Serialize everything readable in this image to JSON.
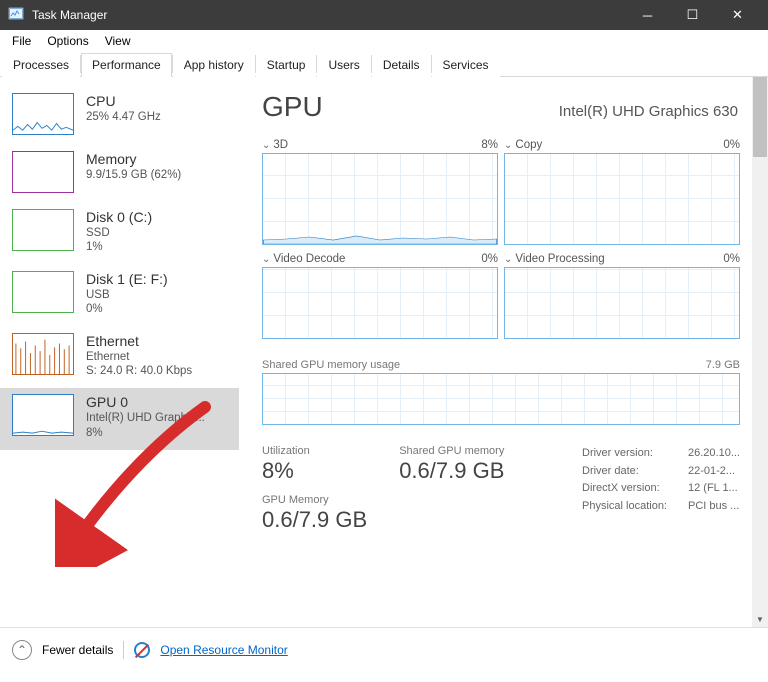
{
  "window": {
    "title": "Task Manager"
  },
  "menubar": [
    "File",
    "Options",
    "View"
  ],
  "tabs": [
    "Processes",
    "Performance",
    "App history",
    "Startup",
    "Users",
    "Details",
    "Services"
  ],
  "active_tab": "Performance",
  "sidebar": [
    {
      "title": "CPU",
      "sub1": "25% 4.47 GHz",
      "sub2": ""
    },
    {
      "title": "Memory",
      "sub1": "9.9/15.9 GB (62%)",
      "sub2": ""
    },
    {
      "title": "Disk 0 (C:)",
      "sub1": "SSD",
      "sub2": "1%"
    },
    {
      "title": "Disk 1 (E: F:)",
      "sub1": "USB",
      "sub2": "0%"
    },
    {
      "title": "Ethernet",
      "sub1": "Ethernet",
      "sub2": "S: 24.0 R: 40.0 Kbps"
    },
    {
      "title": "GPU 0",
      "sub1": "Intel(R) UHD Graphic...",
      "sub2": "8%"
    }
  ],
  "main": {
    "heading": "GPU",
    "device": "Intel(R) UHD Graphics 630",
    "charts": [
      {
        "label": "3D",
        "value": "8%"
      },
      {
        "label": "Copy",
        "value": "0%"
      },
      {
        "label": "Video Decode",
        "value": "0%"
      },
      {
        "label": "Video Processing",
        "value": "0%"
      }
    ],
    "mem": {
      "label": "Shared GPU memory usage",
      "max": "7.9 GB"
    },
    "stats": {
      "util_label": "Utilization",
      "util": "8%",
      "smem_label": "Shared GPU memory",
      "smem": "0.6/7.9 GB",
      "gmem_label": "GPU Memory",
      "gmem": "0.6/7.9 GB"
    },
    "meta": [
      {
        "k": "Driver version:",
        "v": "26.20.10..."
      },
      {
        "k": "Driver date:",
        "v": "22-01-2..."
      },
      {
        "k": "DirectX version:",
        "v": "12 (FL 1..."
      },
      {
        "k": "Physical location:",
        "v": "PCI bus ..."
      }
    ]
  },
  "footer": {
    "fewer": "Fewer details",
    "monitor": "Open Resource Monitor"
  }
}
